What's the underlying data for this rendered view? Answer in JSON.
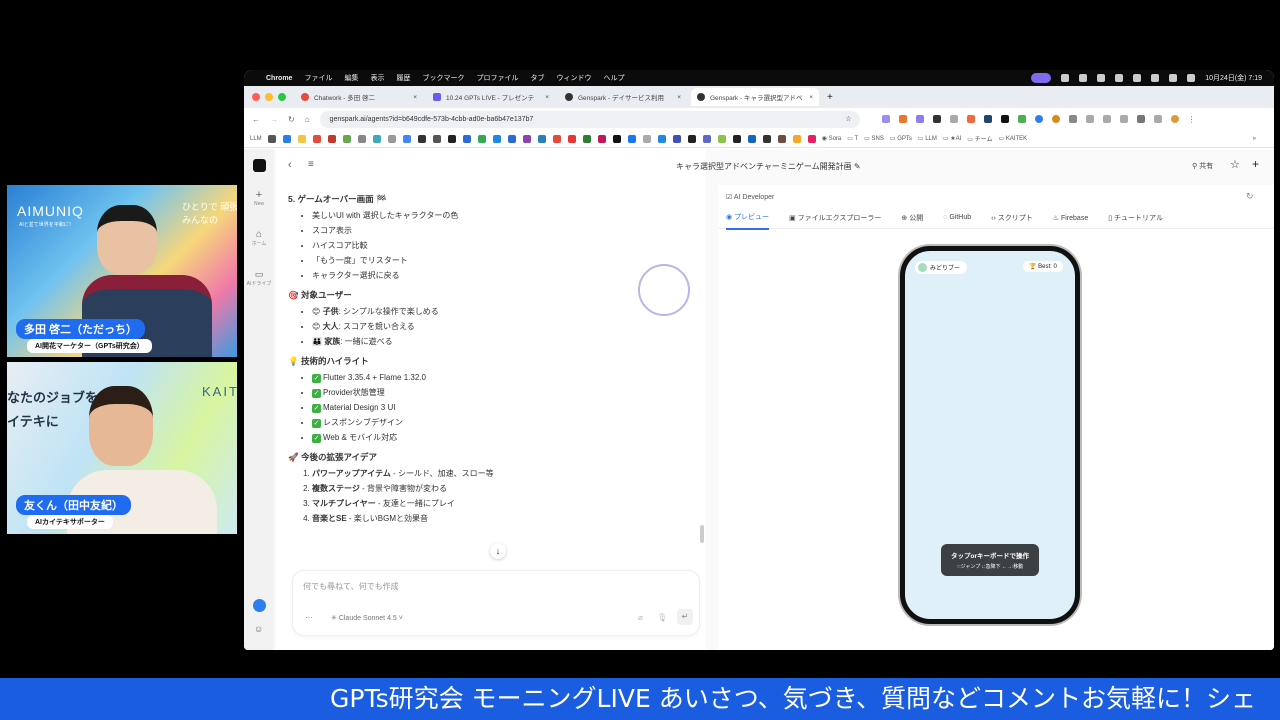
{
  "menubar": {
    "app": "Chrome",
    "items": [
      "ファイル",
      "編集",
      "表示",
      "履歴",
      "ブックマーク",
      "プロファイル",
      "タブ",
      "ウィンドウ",
      "ヘルプ"
    ],
    "clock": "10月24日(金) 7:19"
  },
  "tabs": [
    {
      "label": "Chatwork - 多田 啓二"
    },
    {
      "label": "10.24 GPTs LIVE - プレゼンテ"
    },
    {
      "label": "Genspark - デイサービス利用"
    },
    {
      "label": "Genspark - キャラ選択型アドベ"
    }
  ],
  "url": "genspark.ai/agents?id=b649cdfe-573b-4cbb-ad0e-ba6b47e137b7",
  "bookmarks": {
    "first": "LLM",
    "folders": [
      "Sora",
      "T",
      "SNS",
      "GPTs",
      "LLM",
      "★AI",
      "チーム",
      "KAITEK"
    ],
    "more": "»"
  },
  "bookmark_colors": [
    "#555",
    "#2b7de9",
    "#f4c542",
    "#e24a3b",
    "#c0392b",
    "#6aa84f",
    "#888",
    "#3fa9b5",
    "#999",
    "#4285f4",
    "#333",
    "#555",
    "#222",
    "#2b6ad8",
    "#34a853",
    "#1e88e5",
    "#2b6ad8",
    "#8e44ad",
    "#2980b9",
    "#e24a3b",
    "#e53935",
    "#2e7d32",
    "#c2185b",
    "#111",
    "#1877f2",
    "#aaa",
    "#1e88e5",
    "#3f51b5",
    "#222",
    "#5c6bc0",
    "#8bc34a",
    "#222",
    "#1565c0",
    "#333",
    "#6d4c41",
    "#f9a825",
    "#e91e63"
  ],
  "gs_sidebar": {
    "new": "New",
    "home": "ホーム",
    "drive": "AIドライブ"
  },
  "chat": {
    "sec5_title": "5. ゲームオーバー画面 🏁",
    "sec5_items": [
      "美しいUI with 選択したキャラクターの色",
      "スコア表示",
      "ハイスコア比較",
      "「もう一度」でリスタート",
      "キャラクター選択に戻る"
    ],
    "users_title": "🎯 対象ユーザー",
    "users": [
      {
        "icon": "😊",
        "label": "子供",
        "desc": ": シンプルな操作で楽しめる"
      },
      {
        "icon": "😊",
        "label": "大人",
        "desc": ": スコアを競い合える"
      },
      {
        "icon": "👪",
        "label": "家族",
        "desc": ": 一緒に遊べる"
      }
    ],
    "tech_title": "💡 技術的ハイライト",
    "tech": [
      "Flutter 3.35.4 + Flame 1.32.0",
      "Provider状態管理",
      "Material Design 3 UI",
      "レスポンシブデザイン",
      "Web & モバイル対応"
    ],
    "ideas_title": "🚀 今後の拡張アイデア",
    "ideas": [
      {
        "bold": "パワーアップアイテム",
        "desc": " - シールド、加速、スロー等"
      },
      {
        "bold": "複数ステージ",
        "desc": " - 背景や障害物が変わる"
      },
      {
        "bold": "マルチプレイヤー",
        "desc": " - 友達と一緒にプレイ"
      },
      {
        "bold": "音楽とSE",
        "desc": " - 楽しいBGMと効果音"
      }
    ],
    "input_placeholder": "何でも尋ねて、何でも作成",
    "model": "Claude Sonnet 4.5",
    "more": "···"
  },
  "header": {
    "title": "キャラ選択型アドベンチャーミニゲーム開発計画",
    "share": "共有"
  },
  "panel": {
    "title": "AI Developer",
    "tabs": [
      "プレビュー",
      "ファイルエクスプローラー",
      "公開",
      "GitHub",
      "スクリプト",
      "Firebase",
      "チュートリアル"
    ]
  },
  "phone": {
    "character": "みどりブー",
    "best": "Best: 0",
    "hint_title": "タップorキーボードで操作",
    "hint_sub": "↑:ジャンプ ↓:急降下 ←→:移動"
  },
  "cams": [
    {
      "bg_brand": "AIMUNIQ",
      "bg_tag": "AIと並て世界を平和に！",
      "bg_side": "ひとりで 頑張\nみんなの",
      "name": "多田 啓二（ただっち）",
      "role": "AI開花マーケター（GPTs研究会）"
    },
    {
      "bg_brand": "KAITE",
      "bg_side": "なたのジョブを\nイテキに",
      "name": "友くん（田中友紀）",
      "role": "AIカイテキサポーター"
    }
  ],
  "ticker": "GPTs研究会 モーニングLIVE あいさつ、気づき、質問などコメントお気軽に！シェ"
}
